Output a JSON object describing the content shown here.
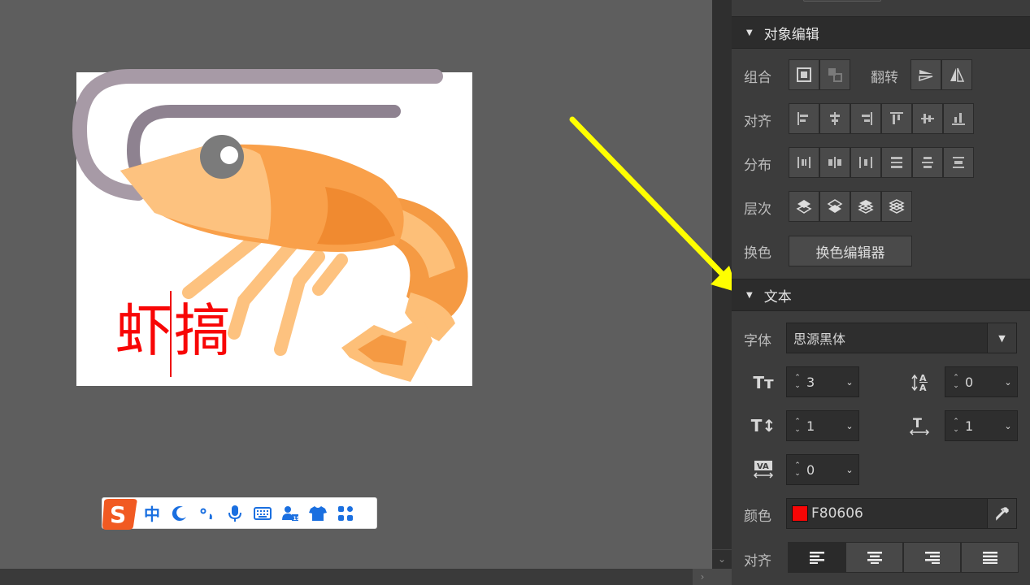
{
  "canvas": {
    "text": "虾搞",
    "text_color": "#F80606"
  },
  "ime": {
    "logo": "sogou-ime-logo",
    "items": [
      "中",
      "☽",
      "°,",
      "mic",
      "keyboard",
      "user-card",
      "shirt",
      "apps"
    ]
  },
  "panel": {
    "object_section": "对象编辑",
    "group_label": "组合",
    "flip_label": "翻转",
    "align_label": "对齐",
    "distribute_label": "分布",
    "layer_label": "层次",
    "swap_color_label": "换色",
    "swap_color_button": "换色编辑器",
    "text_section": "文本",
    "font_label": "字体",
    "font_value": "思源黑体",
    "font_size_value": "3",
    "baseline_value": "0",
    "line_height_value": "1",
    "char_width_value": "1",
    "letter_spacing_value": "0",
    "color_label": "颜色",
    "color_value": "F80606",
    "text_align_label": "对齐"
  },
  "colors": {
    "accent_arrow": "#FFFF00",
    "panel_bg": "#3c3c3c",
    "canvas_bg": "#5e5e5e"
  }
}
